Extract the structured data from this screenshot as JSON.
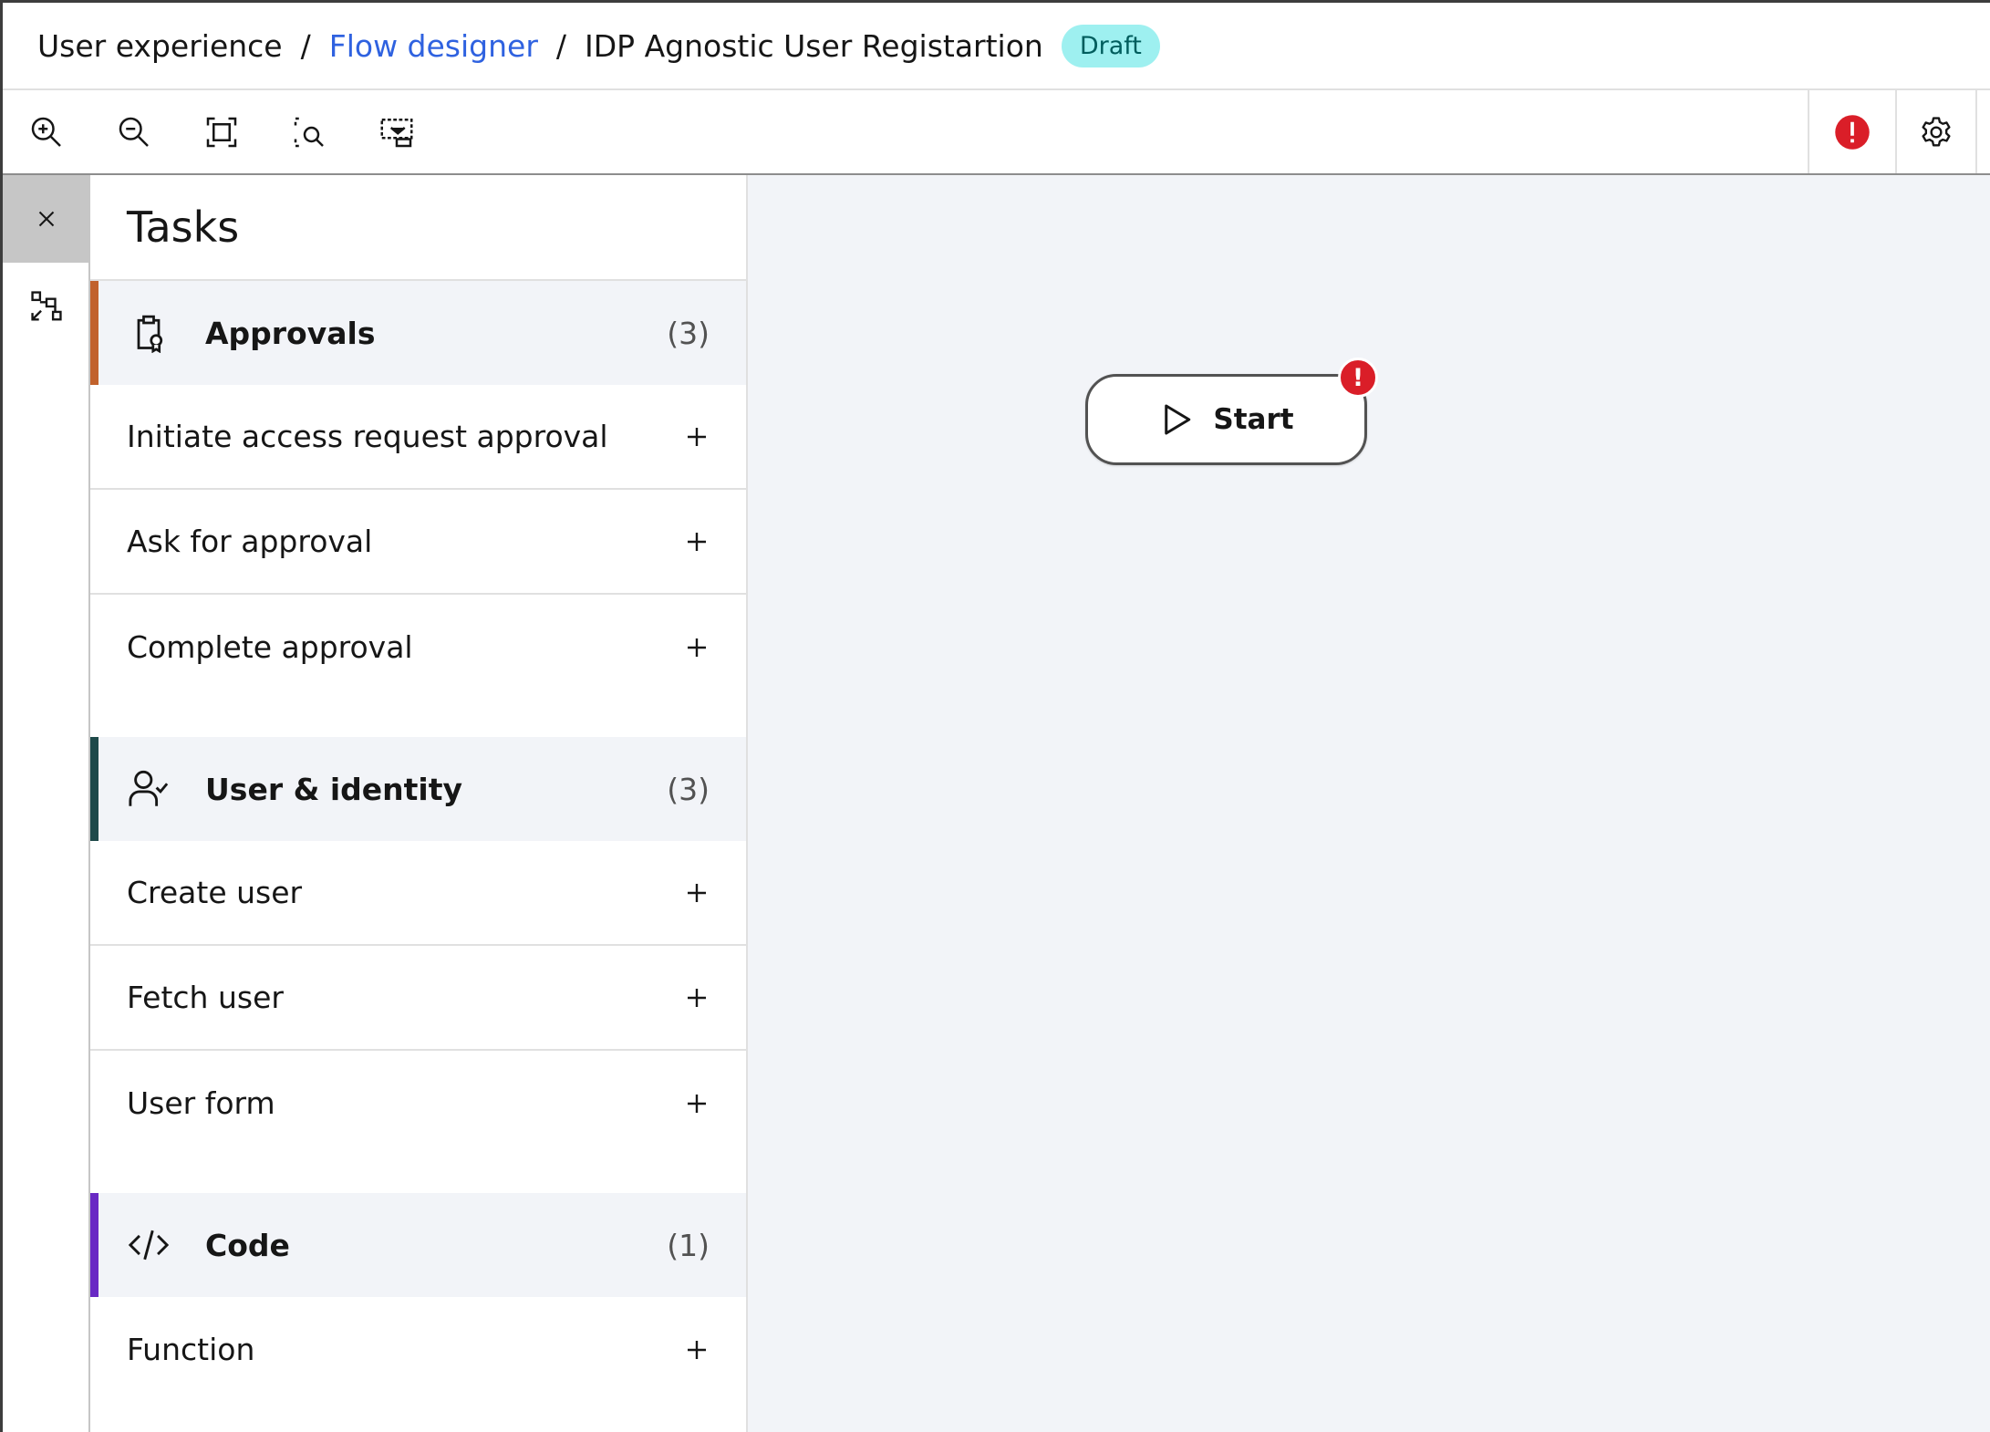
{
  "breadcrumb": {
    "items": [
      {
        "label": "User experience",
        "link": false
      },
      {
        "label": "Flow designer",
        "link": true
      },
      {
        "label": "IDP Agnostic User Registartion",
        "link": false
      }
    ],
    "separator": "/",
    "status": "Draft"
  },
  "toolbar": {
    "tools": [
      "zoom-in-icon",
      "zoom-out-icon",
      "fit-to-screen-icon",
      "zoom-area-icon",
      "minimap-icon"
    ],
    "right": [
      "error-indicator-icon",
      "settings-icon"
    ]
  },
  "rail": {
    "items": [
      "close-icon",
      "flow-tree-icon"
    ]
  },
  "panel": {
    "title": "Tasks",
    "categories": [
      {
        "label": "Approvals",
        "count": "(3)",
        "accent": "#c1622c",
        "icon": "clipboard-badge-icon",
        "tasks": [
          "Initiate access request approval",
          "Ask for approval",
          "Complete approval"
        ]
      },
      {
        "label": "User & identity",
        "count": "(3)",
        "accent": "#1f4a4a",
        "icon": "user-check-icon",
        "tasks": [
          "Create user",
          "Fetch user",
          "User form"
        ]
      },
      {
        "label": "Code",
        "count": "(1)",
        "accent": "#6929c4",
        "icon": "code-icon",
        "tasks": [
          "Function"
        ]
      }
    ]
  },
  "canvas": {
    "start_label": "Start",
    "start_error": "!"
  },
  "colors": {
    "link": "#2f62e0",
    "error": "#da1e28",
    "draft_bg": "#9ef0f0",
    "canvas_bg": "#f2f4f8"
  }
}
